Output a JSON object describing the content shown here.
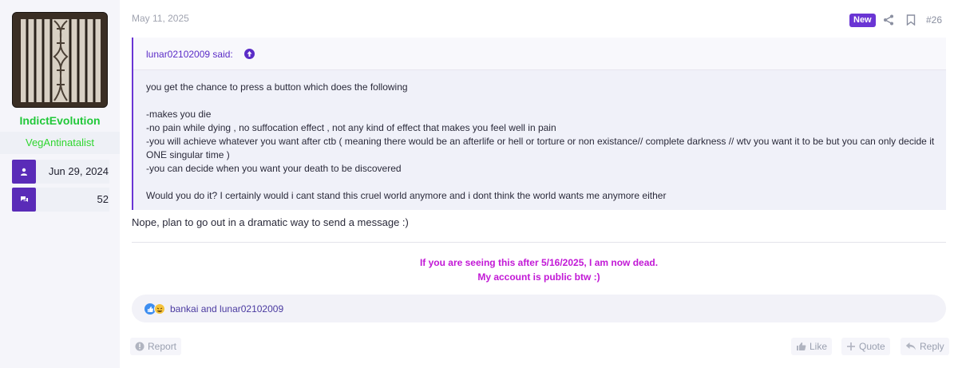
{
  "user": {
    "name": "IndictEvolution",
    "title": "VegAntinatalist",
    "joined": "Jun 29, 2024",
    "messages": "52"
  },
  "post": {
    "date": "May 11, 2025",
    "badge": "New",
    "number": "#26",
    "quote": {
      "author": "lunar02102009 said:",
      "lines": [
        "you get the chance to press a button which does the following",
        "",
        "-makes you die",
        "-no pain while dying , no suffocation effect , not any kind of effect that makes you feel well in pain",
        "-you will achieve whatever you want after ctb ( meaning there would be an afterlife or hell or torture or non existance// complete darkness // wtv you want it to be but you can only decide it ONE singular time )",
        "-you can decide when you want your death to be discovered",
        "",
        "Would you do it? I certainly would i cant stand this cruel world anymore and i dont think the world wants me anymore either"
      ]
    },
    "reply": "Nope, plan to go out in a dramatic way to send a message :)",
    "signature": {
      "line1": "If you are seeing this after 5/16/2025, I am now dead.",
      "line2": "My account is public btw :)"
    },
    "reactions": {
      "text": "bankai and lunar02102009",
      "icons": [
        "like-icon",
        "haha-icon"
      ]
    }
  },
  "actions": {
    "report": "Report",
    "like": "Like",
    "quote": "Quote",
    "reply": "Reply"
  },
  "colors": {
    "accent": "#6a35d4",
    "username": "#22c83a",
    "signature": "#c218d6"
  }
}
